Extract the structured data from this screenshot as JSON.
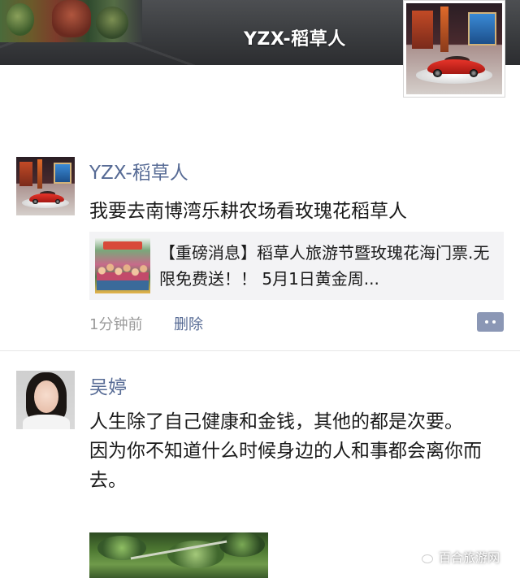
{
  "cover": {
    "username": "YZX-稻草人"
  },
  "posts": [
    {
      "author": "YZX-稻草人",
      "text": "我要去南博湾乐耕农场看玫瑰花稻草人",
      "shared_link": {
        "title": "【重磅消息】稻草人旅游节暨玫瑰花海门票.无限免费送！！ 5月1日黄金周..."
      },
      "time": "1分钟前",
      "delete_label": "删除"
    },
    {
      "author": "吴婷",
      "text": "人生除了自己健康和金钱，其他的都是次要。\n因为你不知道什么时候身边的人和事都会离你而去。"
    }
  ],
  "watermark": {
    "text": "百合旅游网"
  },
  "colors": {
    "name_link": "#576b95",
    "time_gray": "#9a9a9a",
    "card_bg": "#f3f3f5",
    "more_button": "#8b97b5"
  },
  "icons": {
    "more": "more-dots-icon",
    "watermark": "wechat-icon"
  }
}
